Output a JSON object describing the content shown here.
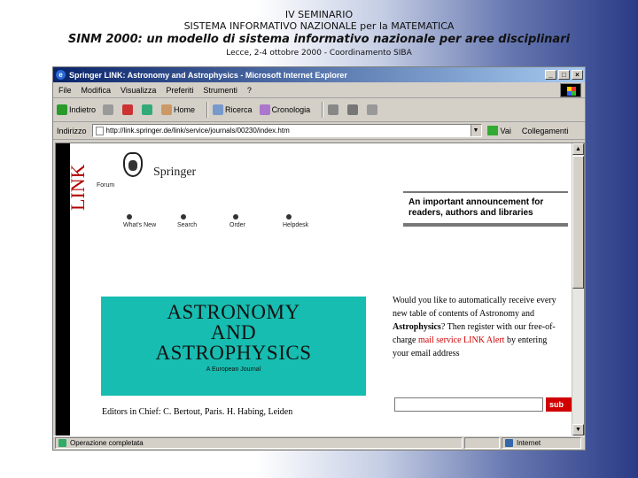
{
  "slide": {
    "line1": "IV SEMINARIO",
    "line2": "SISTEMA INFORMATIVO NAZIONALE per la MATEMATICA",
    "line3": "SINM 2000: un modello di sistema informativo nazionale per aree disciplinari",
    "line4": "Lecce, 2-4 ottobre 2000 - Coordinamento SIBA"
  },
  "browser": {
    "title": "Springer LINK: Astronomy and Astrophysics - Microsoft Internet Explorer",
    "menu": [
      "File",
      "Modifica",
      "Visualizza",
      "Preferiti",
      "Strumenti",
      "?"
    ],
    "toolbar": [
      "Indietro",
      "Home",
      "Ricerca",
      "Cronologia"
    ],
    "address_label": "Indirizzo",
    "url": "http://link.springer.de/link/service/journals/00230/index.htm",
    "go_label": "Vai",
    "links_label": "Collegamenti",
    "status_left": "Operazione completata",
    "status_right": "Internet"
  },
  "page": {
    "logo_text": "LINK",
    "brand": "Springer",
    "forum": "Forum",
    "nav": [
      "What's New",
      "Search",
      "Order",
      "Helpdesk"
    ],
    "announcement": "An important announcement for readers, authors and libraries",
    "cover": {
      "line1": "ASTRONOMY",
      "line2": "AND",
      "line3": "ASTROPHYSICS",
      "subtitle": "A European Journal",
      "color": "#17bdb1"
    },
    "editors": "Editors in Chief: C. Bertout, Paris. H. Habing, Leiden",
    "promo": {
      "part1": "Would you like to automatically receive every new table of contents of Astronomy and",
      "bold": "Astrophysics",
      "part2": "? Then register with our free-of-charge",
      "red": "mail service LINK Alert",
      "part3": "by entering your email address"
    },
    "submit_label": "sub"
  }
}
